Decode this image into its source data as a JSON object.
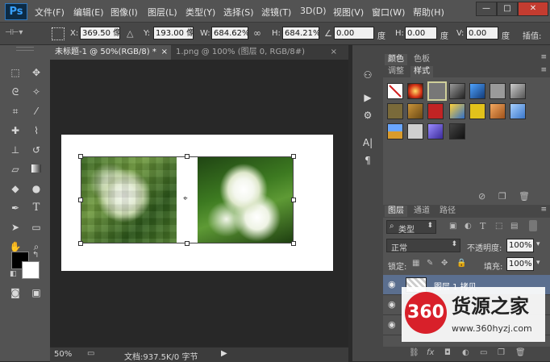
{
  "app": {
    "logo": "Ps"
  },
  "menu": [
    "文件(F)",
    "编辑(E)",
    "图像(I)",
    "图层(L)",
    "类型(Y)",
    "选择(S)",
    "滤镜(T)",
    "3D(D)",
    "视图(V)",
    "窗口(W)",
    "帮助(H)"
  ],
  "window_controls": {
    "minimize": "—",
    "restore": "□",
    "close": "✕"
  },
  "options": {
    "x_label": "X:",
    "x_value": "369.50 像",
    "y_label": "Y:",
    "y_value": "193.00 像",
    "w_label": "W:",
    "w_value": "684.62%",
    "h_label": "H:",
    "h_value": "684.21%",
    "angle_value": "0.00",
    "angle_unit": "度",
    "hskew_label": "H:",
    "hskew_value": "0.00",
    "hskew_unit": "度",
    "vskew_label": "V:",
    "vskew_value": "0.00",
    "vskew_unit": "度",
    "interp_label": "插值:"
  },
  "tabs": [
    {
      "label": "未标题-1 @ 50%(RGB/8) *",
      "close": "×"
    },
    {
      "label": "1.png @ 100% (图层 0, RGB/8#)",
      "close": "×"
    }
  ],
  "status": {
    "zoom": "50%",
    "doc": "文档:937.5K/0 字节"
  },
  "right_panel": {
    "top_tabs": [
      "颜色",
      "色板"
    ],
    "style_tabs": [
      "调整",
      "样式"
    ],
    "layers_tabs": [
      "图层",
      "通道",
      "路径"
    ],
    "filter_label": "类型",
    "blend_mode": "正常",
    "opacity_label": "不透明度:",
    "opacity_value": "100%",
    "lock_label": "锁定:",
    "fill_label": "填充:",
    "fill_value": "100%",
    "layers": [
      "图层 1 拷贝"
    ]
  },
  "watermark": {
    "badge": "360",
    "name": "货源之家",
    "url": "www.360hyzj.com"
  },
  "colors": {
    "accent": "#2d77c0",
    "panel": "#535353",
    "canvas": "#282828",
    "selected_layer": "#5b6f8f"
  }
}
